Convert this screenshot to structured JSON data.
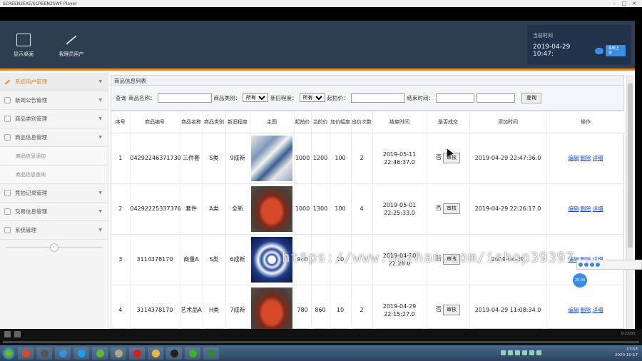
{
  "window": {
    "title": "SCREEN2EXE/SCREEN2SWF Player"
  },
  "header": {
    "buttons": [
      {
        "label": "显示桌面"
      },
      {
        "label": "我理员用户"
      }
    ],
    "time": {
      "label": "当前时间",
      "value": "2019-04-29 10:47:",
      "tag": "系统上传"
    }
  },
  "sidebar": {
    "items": [
      {
        "label": "系统用户管理",
        "active": true
      },
      {
        "label": "新闻公告管理"
      },
      {
        "label": "商品类别管理"
      },
      {
        "label": "商品信息管理"
      },
      {
        "label": "商品信息添加",
        "sub": true
      },
      {
        "label": "商品信息查询",
        "sub": true
      },
      {
        "label": "竞拍记录管理"
      },
      {
        "label": "交易信息管理"
      },
      {
        "label": "系统管理"
      }
    ],
    "collapse_icon": "‹"
  },
  "main": {
    "title": "商品信息列表",
    "search": {
      "label_query": "查询",
      "label_name": "商品名称：",
      "label_category": "商品类别：",
      "category_value": "所有",
      "label_condition": "新旧程度：",
      "condition_value": "所有",
      "label_start_price": "起拍价：",
      "label_end_time": "结束时间：",
      "button": "查询"
    },
    "columns": [
      "序号",
      "商品编号",
      "商品名称",
      "商品类别",
      "新旧程度",
      "主图",
      "起拍价",
      "当前价",
      "加价幅度",
      "出价次数",
      "结束时间",
      "是否成交",
      "添加时间",
      "操作"
    ],
    "rows": [
      {
        "no": "1",
        "code": "04292246371730",
        "name": "三件套",
        "category": "S类",
        "condition": "9成新",
        "start": "1000",
        "current": "1200",
        "step": "100",
        "bids": "2",
        "end_date": "2019-05-11",
        "end_time": "22:46:37.0",
        "deal": "否",
        "review": "审核",
        "added": "2019-04-29 22:47:36.0"
      },
      {
        "no": "2",
        "code": "04292225337376",
        "name": "套件",
        "category": "A类",
        "condition": "全新",
        "start": "1000",
        "current": "1300",
        "step": "100",
        "bids": "4",
        "end_date": "2019-05-01",
        "end_time": "22:25:33.0",
        "deal": "否",
        "review": "审核",
        "added": "2019-04-29 22:26:17.0"
      },
      {
        "no": "3",
        "code": "3114378170",
        "name": "商量A",
        "category": "S类",
        "condition": "6成新",
        "start": "940",
        "current": "",
        "step": "10",
        "bids": "",
        "end_date": "2019-04-10",
        "end_time": "22:28:0",
        "deal": "否",
        "review": "审核",
        "added": "2019-04-29"
      },
      {
        "no": "4",
        "code": "3114378170",
        "name": "艺术品A",
        "category": "H类",
        "condition": "7成新",
        "start": "780",
        "current": "860",
        "step": "10",
        "bids": "2",
        "end_date": "2019-04-29",
        "end_time": "22:15:27.0",
        "deal": "否",
        "review": "审核",
        "added": "2019-04-29 11:08:34.0"
      }
    ],
    "ops": {
      "edit": "编辑",
      "delete": "删除",
      "detail": "详细"
    }
  },
  "overlay": {
    "watermark": "https://www.huzhan.com/ishop39397",
    "float_label": "25.00"
  },
  "taskbar": {
    "time": "17:53",
    "date": "2020-10-17"
  },
  "player": {
    "timecode": "0:23/00"
  }
}
